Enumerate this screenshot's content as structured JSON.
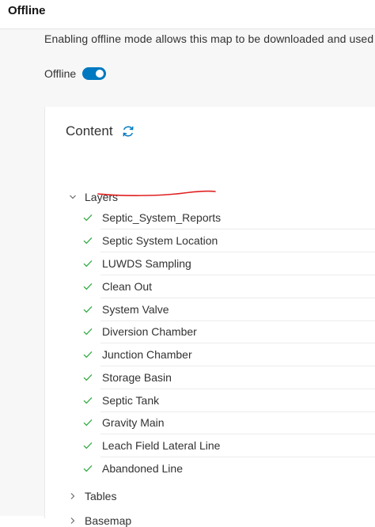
{
  "header": {
    "title": "Offline"
  },
  "offline": {
    "description": "Enabling offline mode allows this map to be downloaded and used i",
    "toggle_label": "Offline",
    "enabled": true
  },
  "content": {
    "title": "Content",
    "layers_group": "Layers",
    "layers": [
      "Septic_System_Reports",
      "Septic System Location",
      "LUWDS Sampling",
      "Clean Out",
      "System Valve",
      "Diversion Chamber",
      "Junction Chamber",
      "Storage Basin",
      "Septic Tank",
      "Gravity Main",
      "Leach Field Lateral Line",
      "Abandoned Line"
    ],
    "tables_group": "Tables",
    "basemap_group": "Basemap"
  },
  "colors": {
    "accent": "#0079c1",
    "check": "#35ac46",
    "annotation": "#e02020"
  },
  "icons": {
    "refresh": "refresh-icon",
    "check": "check-icon",
    "expanded": "chevron-down-icon",
    "collapsed": "chevron-right-icon"
  }
}
